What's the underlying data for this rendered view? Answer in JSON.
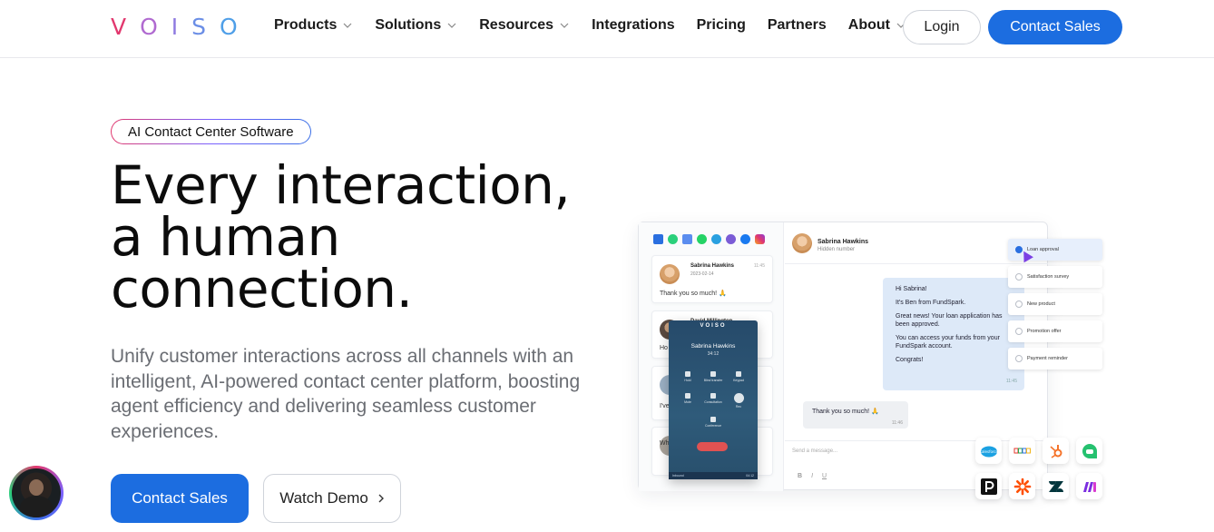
{
  "nav": {
    "logo_letters": [
      "V",
      "O",
      "I",
      "S",
      "O"
    ],
    "logo_colors": [
      "#e2386e",
      "#b06ad0",
      "#8e7ae0",
      "#6b8ee6",
      "#4f9fe8"
    ],
    "items": [
      {
        "label": "Products",
        "has_dropdown": true
      },
      {
        "label": "Solutions",
        "has_dropdown": true
      },
      {
        "label": "Resources",
        "has_dropdown": true
      },
      {
        "label": "Integrations",
        "has_dropdown": false
      },
      {
        "label": "Pricing",
        "has_dropdown": false
      },
      {
        "label": "Partners",
        "has_dropdown": false
      },
      {
        "label": "About",
        "has_dropdown": true
      }
    ],
    "login_label": "Login",
    "contact_label": "Contact Sales"
  },
  "hero": {
    "badge": "AI Contact Center Software",
    "title_lines": [
      "Every interaction,",
      "a human",
      "connection."
    ],
    "subtitle": "Unify customer interactions across all channels with an intelligent, AI-powered contact center platform, boosting agent efficiency and delivering seamless customer experiences.",
    "primary_cta": "Contact Sales",
    "secondary_cta": "Watch Demo",
    "accent_color": "#1c6de0"
  },
  "mockup": {
    "conversations": [
      {
        "name": "Sabrina Hawkins",
        "date": "2023-02-14",
        "time": "11:45",
        "preview": "Thank you so much! 🙏"
      },
      {
        "name": "David Millington",
        "date": "",
        "time": "",
        "preview": "Ho"
      },
      {
        "name": "",
        "date": "",
        "time": "",
        "preview": "I've"
      },
      {
        "name": "",
        "date": "",
        "time": "",
        "preview": "Wh"
      }
    ],
    "phone": {
      "logo": "VOISO",
      "caller": "Sabrina Hawkins",
      "duration": "34:12",
      "buttons": [
        "Hold",
        "Blind transfer",
        "Keypad",
        "Mute",
        "Consultation",
        "Rec",
        "Conference"
      ],
      "footer_left": "Inbound",
      "footer_right": "04:12"
    },
    "chat_header": {
      "name": "Sabrina Hawkins",
      "status": "Hidden number"
    },
    "outgoing": {
      "lines": [
        "Hi Sabrina!",
        "It's Ben from FundSpark.",
        "Great news! Your loan application has been approved.",
        "You can access your funds from your FundSpark account.",
        "Congrats!"
      ],
      "time": "11:45"
    },
    "incoming": {
      "text": "Thank you so much! 🙏",
      "time": "11:46"
    },
    "compose_placeholder": "Send a message...",
    "format_buttons": [
      "B",
      "I",
      "U"
    ],
    "options": [
      {
        "label": "Loan approval",
        "active": true
      },
      {
        "label": "Satisfaction survey",
        "active": false
      },
      {
        "label": "New product",
        "active": false
      },
      {
        "label": "Promotion offer",
        "active": false
      },
      {
        "label": "Payment reminder",
        "active": false
      }
    ],
    "integration_icons": [
      "salesforce-icon",
      "zoho-icon",
      "hubspot-icon",
      "freshdesk-icon",
      "pipedrive-icon",
      "zapier-icon",
      "zendesk-icon",
      "make-icon"
    ],
    "salesforce_label": "salesforce",
    "zoho_label": "ZOHO"
  }
}
